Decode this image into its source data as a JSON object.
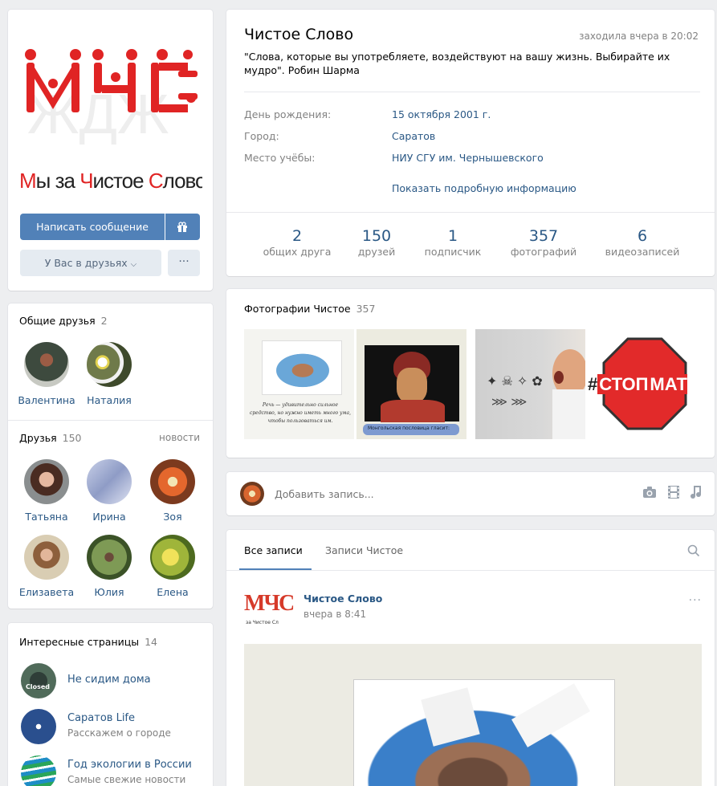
{
  "profile": {
    "name": "Чистое Слово",
    "last_seen": "заходила вчера в 20:02",
    "status": "\"Слова, которые вы употребляете, воздействуют на вашу жизнь. Выбирайте их мудро\". Робин Шарма",
    "info": [
      {
        "key": "День рождения:",
        "value": "15 октября 2001 г."
      },
      {
        "key": "Город:",
        "value": "Саратов"
      },
      {
        "key": "Место учёбы:",
        "value": "НИУ СГУ им. Чернышевского"
      }
    ],
    "show_more": "Показать подробную информацию",
    "stats": [
      {
        "value": "2",
        "label": "общих друга"
      },
      {
        "value": "150",
        "label": "друзей"
      },
      {
        "value": "1",
        "label": "подписчик"
      },
      {
        "value": "357",
        "label": "фотографий"
      },
      {
        "value": "6",
        "label": "видеозаписей"
      }
    ]
  },
  "avatar": {
    "logo_text": "МЧС",
    "caption_parts": [
      "М",
      "ы за ",
      "Ч",
      "истое ",
      "С",
      "лово"
    ],
    "brand_red": "#e02424"
  },
  "actions": {
    "message_button": "Написать сообщение",
    "gift_icon": "gift-icon",
    "friends_button": "У Вас в друзьях",
    "more_button": "···"
  },
  "mutual_friends": {
    "title": "Общие друзья",
    "count": "2",
    "items": [
      {
        "name": "Валентина"
      },
      {
        "name": "Наталия"
      }
    ]
  },
  "friends": {
    "title": "Друзья",
    "count": "150",
    "news_link": "новости",
    "items": [
      {
        "name": "Татьяна"
      },
      {
        "name": "Ирина"
      },
      {
        "name": "Зоя"
      },
      {
        "name": "Елизавета"
      },
      {
        "name": "Юлия"
      },
      {
        "name": "Елена"
      }
    ]
  },
  "pages": {
    "title": "Интересные страницы",
    "count": "14",
    "items": [
      {
        "name": "Не сидим дома",
        "subtitle": "",
        "avatar_text": "Closed"
      },
      {
        "name": "Саратов Life",
        "subtitle": "Расскажем о городе",
        "avatar_text": ""
      },
      {
        "name": "Год экологии в России",
        "subtitle": "Самые свежие новости",
        "avatar_text": ""
      }
    ]
  },
  "photos": {
    "title": "Фотографии Чистое",
    "count": "357",
    "photo4_text_hash": "#",
    "photo4_text_a": "СТОП",
    "photo4_text_b": "МАТ",
    "photo1_caption": "Речь — удивительно сильное средство, но нужно иметь много ума, чтобы пользоваться им.",
    "photo2_caption": "Монгольская пословица гласит:"
  },
  "composer": {
    "placeholder": "Добавить запись..."
  },
  "wall": {
    "tabs": [
      {
        "label": "Все записи",
        "active": true
      },
      {
        "label": "Записи Чистое",
        "active": false
      }
    ],
    "post": {
      "author": "Чистое Слово",
      "time": "вчера в 8:41",
      "avatar_text": "МЧС",
      "avatar_caption": "за Чистое Сл"
    }
  }
}
